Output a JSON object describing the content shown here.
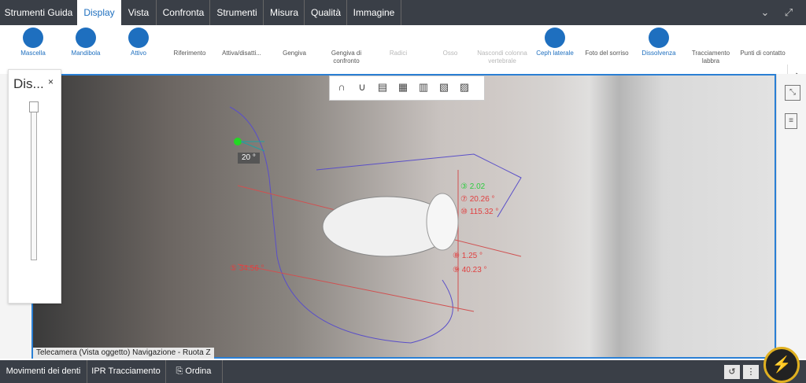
{
  "topbar": {
    "tabs": [
      {
        "label": "Strumenti Guida"
      },
      {
        "label": "Display"
      },
      {
        "label": "Vista"
      },
      {
        "label": "Confronta"
      },
      {
        "label": "Strumenti"
      },
      {
        "label": "Misura"
      },
      {
        "label": "Qualità"
      },
      {
        "label": "Immagine"
      }
    ],
    "icons": [
      "chevron-circle-icon",
      "expand-icon"
    ]
  },
  "ribbon": {
    "items": [
      {
        "label": "Mascella",
        "state": "on",
        "icon": "maxilla-icon"
      },
      {
        "label": "Mandibola",
        "state": "on",
        "icon": "mandible-icon"
      },
      {
        "label": "Attivo",
        "state": "on",
        "icon": "active-jaw-icon"
      },
      {
        "label": "Riferimento",
        "state": "off",
        "icon": "reference-icon"
      },
      {
        "label": "Attiva/disatti...",
        "state": "off",
        "icon": "toggle-icon"
      },
      {
        "label": "Gengiva",
        "state": "off",
        "icon": "gingiva-icon"
      },
      {
        "label": "Gengiva di confronto",
        "state": "off",
        "icon": "compare-gingiva-icon"
      },
      {
        "label": "Radici",
        "state": "disabled",
        "icon": "roots-icon"
      },
      {
        "label": "Osso",
        "state": "disabled",
        "icon": "bone-icon"
      },
      {
        "label": "Nascondi colonna vertebrale",
        "state": "disabled",
        "icon": "spine-icon"
      },
      {
        "label": "Ceph laterale",
        "state": "on",
        "icon": "ceph-icon"
      },
      {
        "label": "Foto del sorriso",
        "state": "off",
        "icon": "smile-photo-icon"
      },
      {
        "label": "Dissolvenza",
        "state": "on",
        "icon": "fade-icon"
      },
      {
        "label": "Tracciamento labbra",
        "state": "off",
        "icon": "lip-trace-icon"
      },
      {
        "label": "Punti di contatto",
        "state": "off",
        "icon": "contact-points-icon"
      }
    ]
  },
  "panel": {
    "title": "Dis...",
    "close": "×"
  },
  "viewport": {
    "camera_label": "Telecamera (Vista oggetto) Navigazione - Ruota Z",
    "angle_badge": "20 °",
    "annotations": [
      {
        "text": "③ 2.02",
        "color": "#2ecc40"
      },
      {
        "text": "⑦ 20.26 °",
        "color": "#e04040"
      },
      {
        "text": "⑩ 115.32 °",
        "color": "#e04040"
      },
      {
        "text": "⑧ 1.25 °",
        "color": "#e04040"
      },
      {
        "text": "⑨ 40.23 °",
        "color": "#e04040"
      },
      {
        "text": "⑤ 34.56 °",
        "color": "#e04040"
      }
    ]
  },
  "bottombar": {
    "items": [
      {
        "label": "Movimenti dei denti"
      },
      {
        "label": "IPR Tracciamento"
      },
      {
        "label": "Ordina"
      }
    ]
  }
}
